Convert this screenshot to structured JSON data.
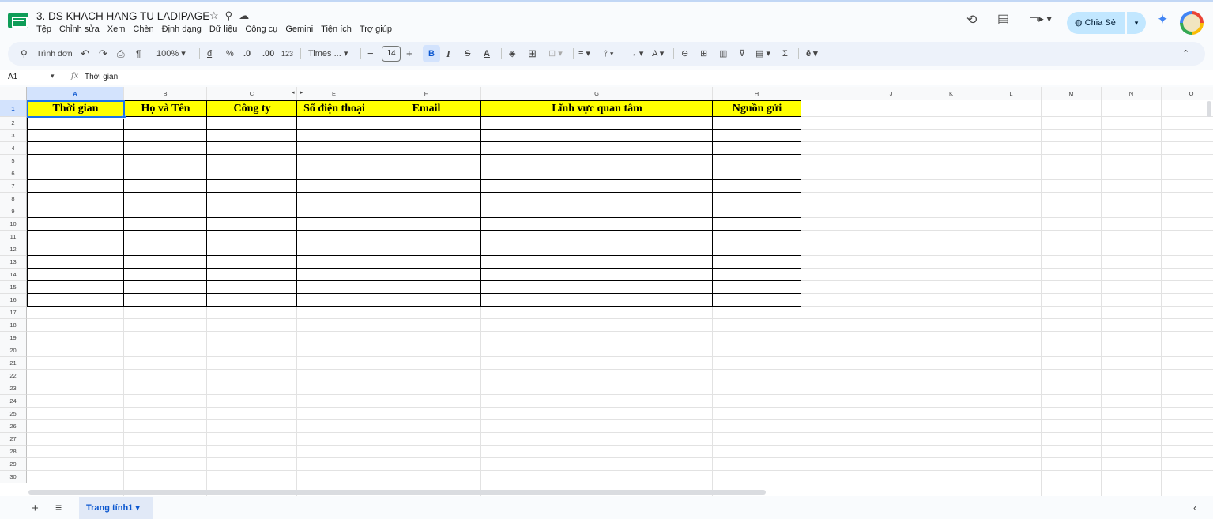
{
  "app": {
    "doc_title": "3. DS KHACH HANG TU LADIPAGE",
    "menu": [
      "Tệp",
      "Chỉnh sửa",
      "Xem",
      "Chèn",
      "Định dạng",
      "Dữ liệu",
      "Công cụ",
      "Gemini",
      "Tiện ích",
      "Trợ giúp"
    ],
    "share_label": "Chia Sẻ"
  },
  "toolbar": {
    "search_menus": "Trình đơn",
    "zoom": "100%",
    "currency": "đ",
    "percent": "%",
    "decrease_decimal": ".0",
    "increase_decimal": ".00",
    "number_format": "123",
    "font": "Times ...",
    "font_size": "14",
    "bold": "B",
    "italic": "I"
  },
  "formula_bar": {
    "name_box": "A1",
    "fx": "fx",
    "value": "Thời gian"
  },
  "sheet": {
    "columns": [
      "A",
      "B",
      "C",
      "E",
      "F",
      "G",
      "H",
      "I",
      "J",
      "K",
      "L",
      "M",
      "N",
      "O"
    ],
    "rows": [
      "1",
      "2",
      "3",
      "4",
      "5",
      "6",
      "7",
      "8",
      "9",
      "10",
      "11",
      "12",
      "13",
      "14",
      "15",
      "16",
      "17",
      "18",
      "19",
      "20",
      "21",
      "22",
      "23",
      "24",
      "25",
      "26",
      "27",
      "28",
      "29",
      "30"
    ],
    "headers": [
      "Thời gian",
      "Họ và Tên",
      "Công ty",
      "Số điện thoại",
      "Email",
      "Lĩnh vực quan tâm",
      "Nguồn gửi"
    ],
    "header_fill": "#ffff00",
    "selection_color": "#1a73e8"
  },
  "tabs": {
    "active_sheet": "Trang tính1"
  }
}
